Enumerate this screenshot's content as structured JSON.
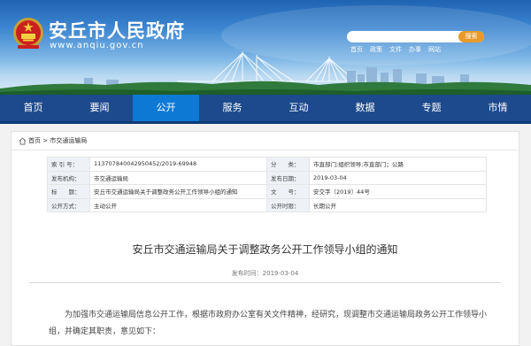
{
  "site": {
    "title": "安丘市人民政府",
    "url": "www.anqiu.gov.cn"
  },
  "search": {
    "button": "搜索",
    "placeholder": ""
  },
  "quick_links": [
    "首页",
    "政策",
    "文件",
    "办事",
    "网站"
  ],
  "nav": {
    "items": [
      "首页",
      "要闻",
      "公开",
      "服务",
      "互动",
      "数据",
      "专题",
      "市情"
    ],
    "active_index": 2,
    "active_color": "#0e78d5",
    "bar_color": "#1d4a8c"
  },
  "breadcrumb": {
    "home": "首页",
    "current": "市交通运输局"
  },
  "meta": {
    "rows": [
      {
        "l1": "索 引 号：",
        "v1": "11370784004295045​2/2019-69948",
        "l2": "分　　类：",
        "v2": "市直部门;组织领导;市直部门；公路"
      },
      {
        "l1": "发布机构：",
        "v1": "市交通运输局",
        "l2": "发布日期：",
        "v2": "2019-03-04"
      },
      {
        "l1": "标　　题：",
        "v1": "安丘市交通运输局关于调整政务公开工作领导小组的通知",
        "l2": "文　　号：",
        "v2": "安交字〔2019〕44号"
      },
      {
        "l1": "公开方式：",
        "v1": "主动公开",
        "l2": "公开时限：",
        "v2": "长期公开"
      }
    ]
  },
  "document": {
    "title": "安丘市交通运输局关于调整政务公开工作领导小组的通知",
    "published": "发布时间：2019-03-04",
    "body": "为加强市交通运输局信息公开工作，根据市政府办公室有关文件精神，经研究，现调整市交通运输局政务公开工作领导小组，并确定其职责，意见如下："
  }
}
